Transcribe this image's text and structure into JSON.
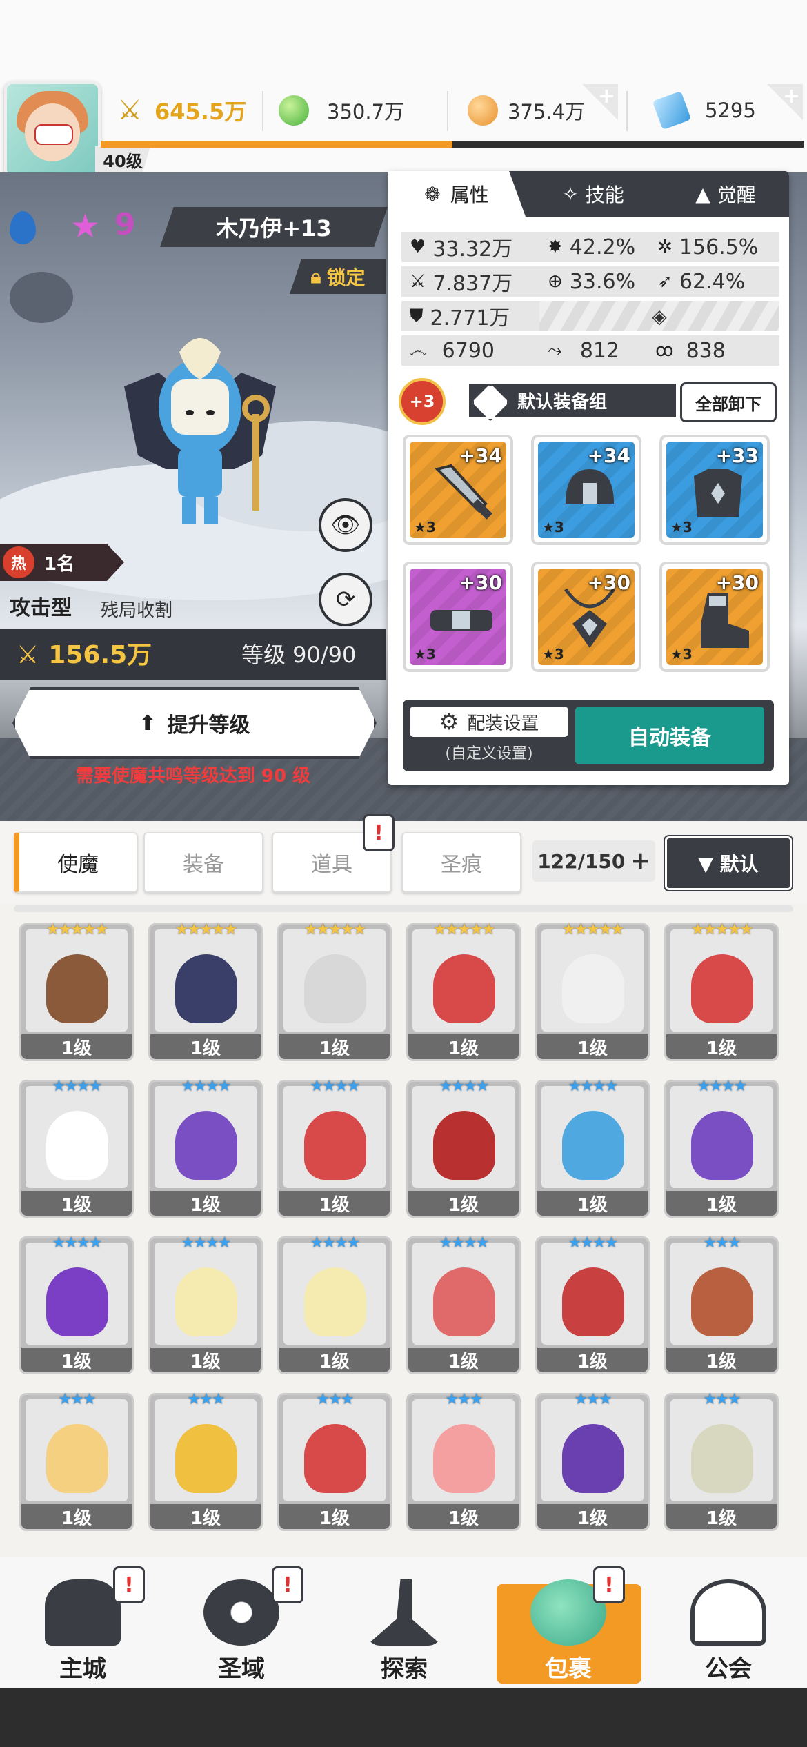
{
  "topbar": {
    "level": "40级",
    "power": "645.5万",
    "gold_green": "350.7万",
    "gold_orange": "375.4万",
    "gems": "5295",
    "xp_fraction": 0.5
  },
  "hero": {
    "stars": "9",
    "name": "木乃伊+13",
    "lock_label": "锁定",
    "rank": "1名",
    "rank_icon_label": "热",
    "type": "攻击型",
    "skill_tag": "残局收割",
    "power": "156.5万",
    "level_text": "等级 90/90",
    "upgrade_label": "提升等级",
    "requirement": "需要使魔共鸣等级达到 90 级"
  },
  "panel": {
    "tabs": [
      "属性",
      "技能",
      "觉醒"
    ],
    "stats": {
      "hp": "33.32万",
      "crit": "42.2%",
      "crit_dmg": "156.5%",
      "atk": "7.837万",
      "hit": "33.6%",
      "speed": "62.4%",
      "def": "2.771万",
      "s1": "6790",
      "s2": "812",
      "s3": "838"
    },
    "equip_plus": "+3",
    "equip_set": "默认装备组",
    "unequip_all": "全部卸下",
    "equipment": [
      {
        "plus": "+34",
        "star": "★3",
        "kind": "sword",
        "color": "#f0a030"
      },
      {
        "plus": "+34",
        "star": "★3",
        "kind": "helmet",
        "color": "#3b9de0"
      },
      {
        "plus": "+33",
        "star": "★3",
        "kind": "armor",
        "color": "#3b9de0"
      },
      {
        "plus": "+30",
        "star": "★3",
        "kind": "belt",
        "color": "#c45fd0"
      },
      {
        "plus": "+30",
        "star": "★3",
        "kind": "amulet",
        "color": "#f0a030"
      },
      {
        "plus": "+30",
        "star": "★3",
        "kind": "boots",
        "color": "#f0a030"
      }
    ],
    "config_label": "配装设置",
    "config_sub": "(自定义设置)",
    "auto_equip": "自动装备"
  },
  "bag_tabs": [
    "使魔",
    "装备",
    "道具",
    "圣痕"
  ],
  "count": "122/150",
  "sort_label": "▼ 默认",
  "cards": [
    {
      "stars": "★★★★★",
      "lvl": "1级",
      "bg": "#e7e7e7",
      "mon": "#8a5a3a",
      "blue": false
    },
    {
      "stars": "★★★★★",
      "lvl": "1级",
      "bg": "#e7e7e7",
      "mon": "#3a3f6a",
      "blue": false
    },
    {
      "stars": "★★★★★",
      "lvl": "1级",
      "bg": "#e7e7e7",
      "mon": "#d8d8d8",
      "blue": false
    },
    {
      "stars": "★★★★★",
      "lvl": "1级",
      "bg": "#e7e7e7",
      "mon": "#d84a4a",
      "blue": false
    },
    {
      "stars": "★★★★★",
      "lvl": "1级",
      "bg": "#e7e7e7",
      "mon": "#f0f0f0",
      "blue": false
    },
    {
      "stars": "★★★★★",
      "lvl": "1级",
      "bg": "#e7e7e7",
      "mon": "#d84a4a",
      "blue": false
    },
    {
      "stars": "★★★★",
      "lvl": "1级",
      "bg": "#e7e7e7",
      "mon": "#ffffff",
      "blue": true
    },
    {
      "stars": "★★★★",
      "lvl": "1级",
      "bg": "#e7e7e7",
      "mon": "#7a4fc4",
      "blue": true
    },
    {
      "stars": "★★★★",
      "lvl": "1级",
      "bg": "#e7e7e7",
      "mon": "#d84a4a",
      "blue": true
    },
    {
      "stars": "★★★★",
      "lvl": "1级",
      "bg": "#e7e7e7",
      "mon": "#b83030",
      "blue": true
    },
    {
      "stars": "★★★★",
      "lvl": "1级",
      "bg": "#e7e7e7",
      "mon": "#4fa8e0",
      "blue": true
    },
    {
      "stars": "★★★★",
      "lvl": "1级",
      "bg": "#e7e7e7",
      "mon": "#7a4fc4",
      "blue": true
    },
    {
      "stars": "★★★★",
      "lvl": "1级",
      "bg": "#e7e7e7",
      "mon": "#7a3fc4",
      "blue": true
    },
    {
      "stars": "★★★★",
      "lvl": "1级",
      "bg": "#e7e7e7",
      "mon": "#f5eab0",
      "blue": true
    },
    {
      "stars": "★★★★",
      "lvl": "1级",
      "bg": "#e7e7e7",
      "mon": "#f5eab0",
      "blue": true
    },
    {
      "stars": "★★★★",
      "lvl": "1级",
      "bg": "#e7e7e7",
      "mon": "#e06a6a",
      "blue": true
    },
    {
      "stars": "★★★★",
      "lvl": "1级",
      "bg": "#e7e7e7",
      "mon": "#c84040",
      "blue": true
    },
    {
      "stars": "★★★",
      "lvl": "1级",
      "bg": "#e7e7e7",
      "mon": "#b86040",
      "blue": true
    },
    {
      "stars": "★★★",
      "lvl": "1级",
      "bg": "#e7e7e7",
      "mon": "#f5d080",
      "blue": true
    },
    {
      "stars": "★★★",
      "lvl": "1级",
      "bg": "#e7e7e7",
      "mon": "#f0c040",
      "blue": true
    },
    {
      "stars": "★★★",
      "lvl": "1级",
      "bg": "#e7e7e7",
      "mon": "#d84a4a",
      "blue": true
    },
    {
      "stars": "★★★",
      "lvl": "1级",
      "bg": "#e7e7e7",
      "mon": "#f5a0a0",
      "blue": true
    },
    {
      "stars": "★★★",
      "lvl": "1级",
      "bg": "#e7e7e7",
      "mon": "#6a3fb0",
      "blue": true
    },
    {
      "stars": "★★★",
      "lvl": "1级",
      "bg": "#e7e7e7",
      "mon": "#d8d8c0",
      "blue": true
    }
  ],
  "nav": [
    {
      "label": "主城",
      "icon": "castle-icon"
    },
    {
      "label": "圣域",
      "icon": "portal-icon"
    },
    {
      "label": "探索",
      "icon": "sword-stone-icon"
    },
    {
      "label": "包裹",
      "icon": "bag-icon"
    },
    {
      "label": "公会",
      "icon": "guild-icon"
    }
  ],
  "colors": {
    "accent": "#f39a24",
    "dark": "#3a3d43",
    "teal": "#1a9a8c",
    "alert": "#f03c3c"
  }
}
